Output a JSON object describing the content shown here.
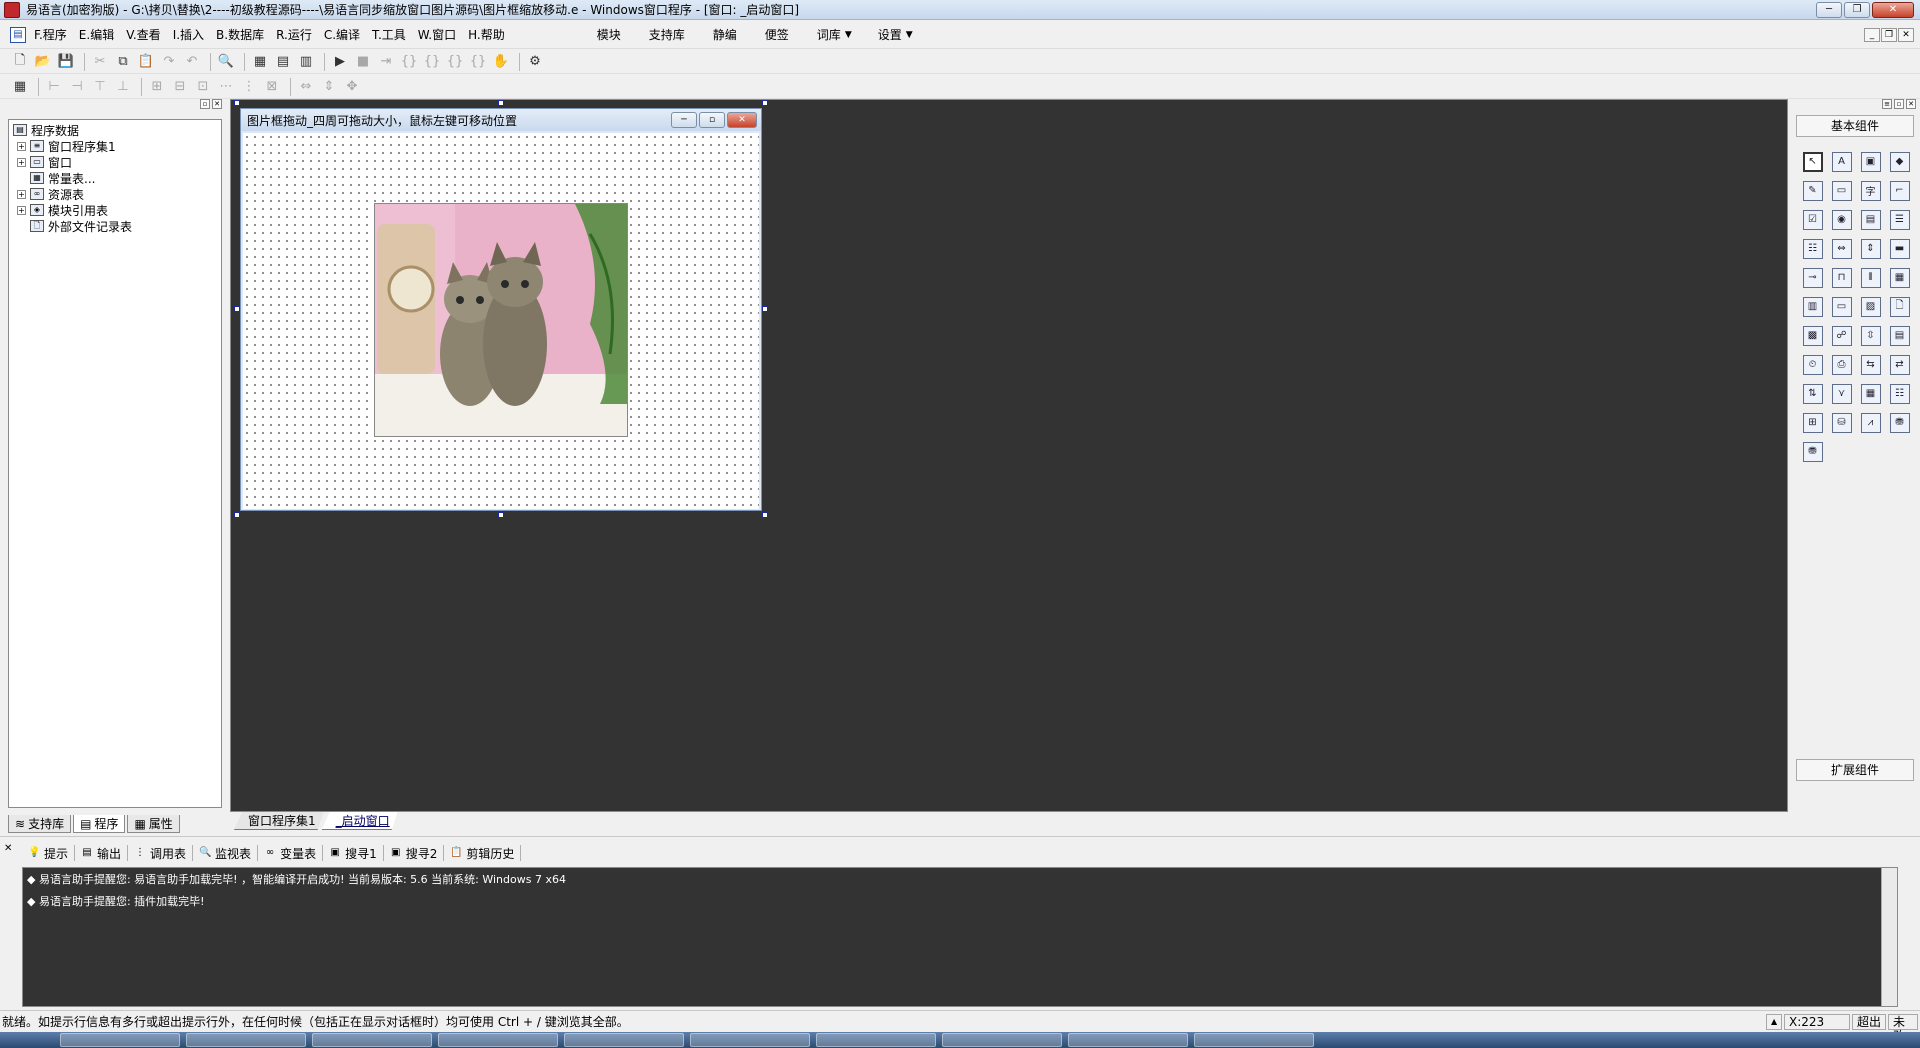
{
  "title_bar": {
    "title": "易语言(加密狗版) - G:\\拷贝\\替换\\2----初级教程源码----\\易语言同步缩放窗口图片源码\\图片框缩放移动.e - Windows窗口程序 - [窗口: _启动窗口]"
  },
  "menu": {
    "items": [
      "F.程序",
      "E.编辑",
      "V.查看",
      "I.插入",
      "B.数据库",
      "R.运行",
      "C.编译",
      "T.工具",
      "W.窗口",
      "H.帮助"
    ],
    "extra": [
      "模块",
      "支持库",
      "静编",
      "便签",
      "词库",
      "设置"
    ]
  },
  "tree": {
    "root": "程序数据",
    "items": [
      "窗口程序集1",
      "窗口",
      "常量表...",
      "资源表",
      "模块引用表",
      "外部文件记录表"
    ]
  },
  "left_tabs": [
    "支持库",
    "程序",
    "属性"
  ],
  "design_window": {
    "title": "图片框拖动_四周可拖动大小，鼠标左键可移动位置"
  },
  "doc_tabs": [
    "窗口程序集1",
    "_启动窗口"
  ],
  "palette": {
    "header": "基本组件",
    "footer": "扩展组件"
  },
  "bottom_tabs": [
    "提示",
    "输出",
    "调用表",
    "监视表",
    "变量表",
    "搜寻1",
    "搜寻2",
    "剪辑历史"
  ],
  "output": {
    "lines": [
      "◆ 易语言助手提醒您: 易语言助手加载完毕! ，智能编译开启成功!  当前易版本: 5.6  当前系统: Windows 7 x64",
      "◆ 易语言助手提醒您: 插件加载完毕!"
    ]
  },
  "status": {
    "message": "就绪。如提示行信息有多行或超出提示行外，在任何时候（包括正在显示对话框时）均可使用 Ctrl + / 键浏览其全部。",
    "coord": "X:223",
    "mode": "超出",
    "state": "未改"
  }
}
